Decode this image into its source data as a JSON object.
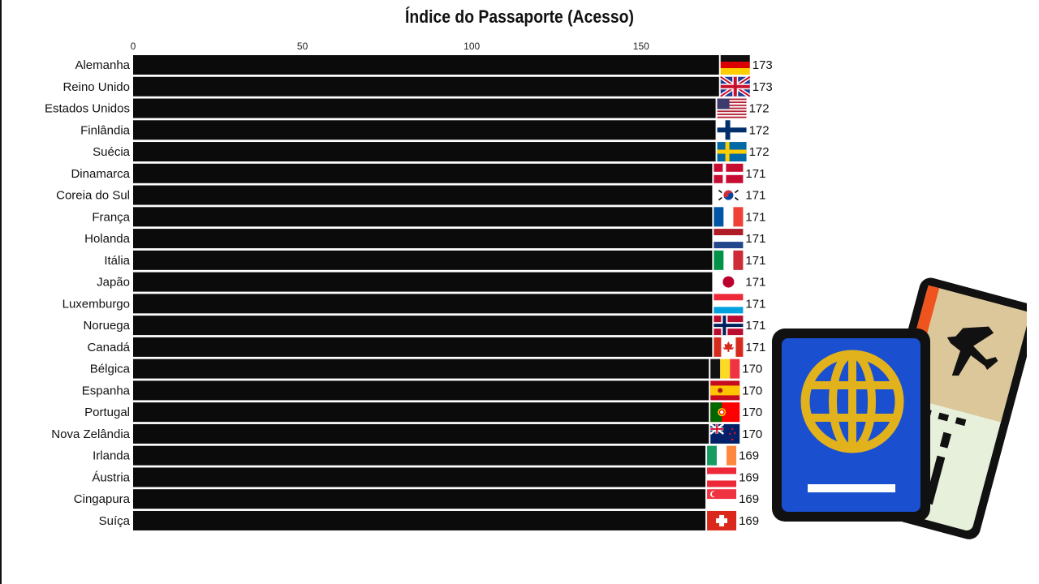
{
  "chart_data": {
    "type": "bar",
    "orientation": "horizontal",
    "title": "Índice do Passaporte (Acesso)",
    "xlabel": "",
    "ylabel": "",
    "xlim": [
      0,
      173
    ],
    "x_ticks": [
      0,
      50,
      100,
      150
    ],
    "x_tick_labels": [
      "0",
      "50",
      "100",
      "150"
    ],
    "x_axis_position": "top",
    "grid": false,
    "bar_color": "#0b0b0c",
    "categories": [
      "Alemanha",
      "Reino Unido",
      "Estados Unidos",
      "Finlândia",
      "Suécia",
      "Dinamarca",
      "Coreia do Sul",
      "França",
      "Holanda",
      "Itália",
      "Japão",
      "Luxemburgo",
      "Noruega",
      "Canadá",
      "Bélgica",
      "Espanha",
      "Portugal",
      "Nova Zelândia",
      "Irlanda",
      "Áustria",
      "Cingapura",
      "Suíça"
    ],
    "values": [
      173,
      173,
      172,
      172,
      172,
      171,
      171,
      171,
      171,
      171,
      171,
      171,
      171,
      171,
      170,
      170,
      170,
      170,
      169,
      169,
      169,
      169
    ],
    "value_labels": [
      "173",
      "173",
      "172",
      "172",
      "172",
      "171",
      "171",
      "171",
      "171",
      "171",
      "171",
      "171",
      "171",
      "171",
      "170",
      "170",
      "170",
      "170",
      "169",
      "169",
      "169",
      "169"
    ],
    "flags": [
      "germany-flag",
      "uk-flag",
      "usa-flag",
      "finland-flag",
      "sweden-flag",
      "denmark-flag",
      "south-korea-flag",
      "france-flag",
      "netherlands-flag",
      "italy-flag",
      "japan-flag",
      "luxembourg-flag",
      "norway-flag",
      "canada-flag",
      "belgium-flag",
      "spain-flag",
      "portugal-flag",
      "new-zealand-flag",
      "ireland-flag",
      "austria-flag",
      "singapore-flag",
      "switzerland-flag"
    ]
  },
  "illustration": {
    "icon": "passport-and-boarding-pass-icon",
    "passport_color": "#1a4fd0",
    "globe_color": "#e2b21c",
    "ticket_top_color": "#dcc79a",
    "ticket_bottom_color": "#e6f0da",
    "ticket_stripe_color": "#f0541e"
  }
}
